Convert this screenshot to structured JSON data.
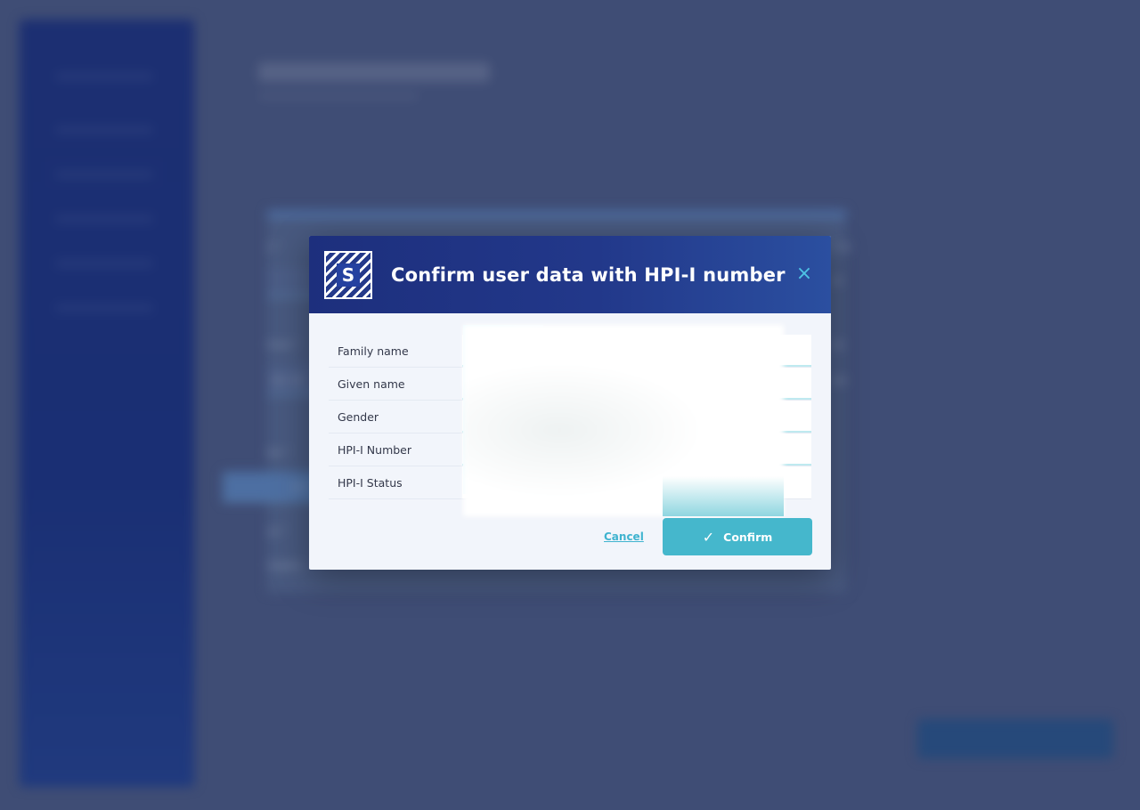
{
  "modal": {
    "title": "Confirm user data with HPI-I number",
    "logo_letter": "S",
    "close_icon": "×",
    "fields": [
      {
        "label": "Family name",
        "value": ""
      },
      {
        "label": "Given name",
        "value": ""
      },
      {
        "label": "Gender",
        "value": ""
      },
      {
        "label": "HPI-I Number",
        "value": ""
      },
      {
        "label": "HPI-I Status",
        "value": ""
      }
    ],
    "cancel_label": "Cancel",
    "confirm_label": "Confirm",
    "confirm_icon": "✓"
  },
  "background": {
    "labels": [
      "e *",
      "hone *",
      "321 32",
      "ber *",
      "123",
      "on *",
      "Implem",
      "t na",
      "ivi",
      "de",
      "ale"
    ]
  },
  "colors": {
    "overlay": "#3f4d75",
    "header_start": "#1d2f7d",
    "header_end": "#2b4fa0",
    "accent": "#45b7cc",
    "link": "#3fb3cf"
  }
}
